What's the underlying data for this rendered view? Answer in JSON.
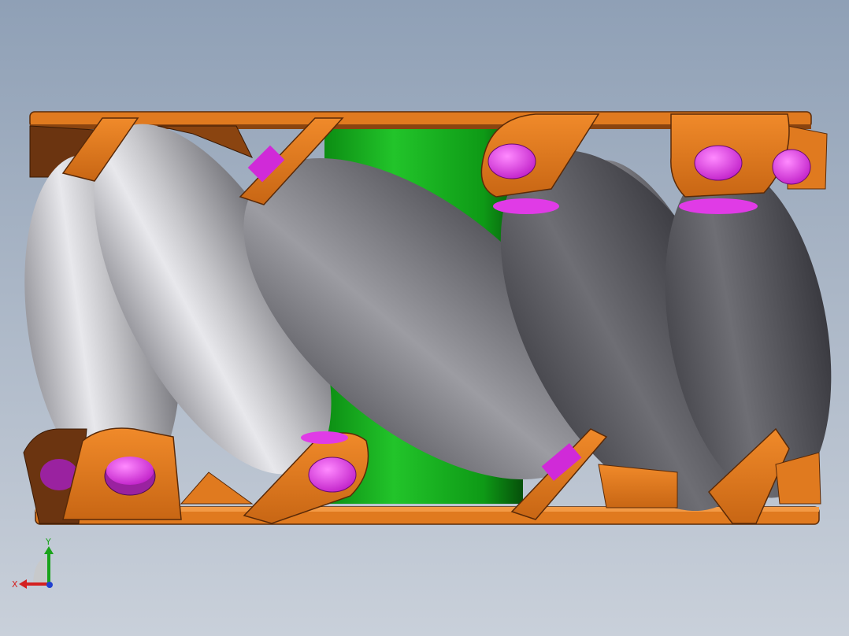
{
  "viewport": {
    "background_top": "#8fa0b6",
    "background_bottom": "#c9d0da"
  },
  "model": {
    "hub_color": "#15a51d",
    "frame_color": "#e07a1f",
    "frame_dark": "#6b3410",
    "roller_color": "#8a8a8e",
    "axle_color": "#e03be6"
  },
  "triad": {
    "x_label": "X",
    "y_label": "Y",
    "x_color": "#d42020",
    "y_color": "#1aa31a",
    "z_color": "#2040d0"
  }
}
